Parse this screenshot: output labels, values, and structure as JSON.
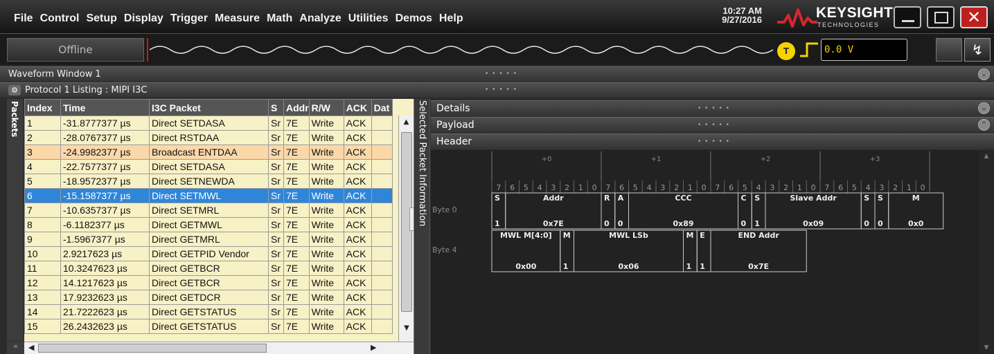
{
  "menu": [
    "File",
    "Control",
    "Setup",
    "Display",
    "Trigger",
    "Measure",
    "Math",
    "Analyze",
    "Utilities",
    "Demos",
    "Help"
  ],
  "clock": {
    "time": "10:27 AM",
    "date": "9/27/2016"
  },
  "brand": {
    "name": "KEYSIGHT",
    "sub": "TECHNOLOGIES"
  },
  "toolbar": {
    "status": "Offline",
    "trigger_label": "T",
    "trigger_level": "0.0 V"
  },
  "panels": {
    "waveform_title": "Waveform Window 1",
    "protocol_title": "Protocol 1 Listing : MIPI I3C",
    "packets_tab": "Packets",
    "selected_tab": "Selected Packet Information",
    "details": "Details",
    "payload": "Payload",
    "header": "Header"
  },
  "listing": {
    "columns": [
      "Index",
      "Time",
      "I3C Packet",
      "S",
      "Addr",
      "R/W",
      "ACK",
      "Dat"
    ],
    "rows": [
      [
        "1",
        "-31.8777377 µs",
        "Direct SETDASA",
        "Sr",
        "7E",
        "Write",
        "ACK"
      ],
      [
        "2",
        "-28.0767377 µs",
        "Direct RSTDAA",
        "Sr",
        "7E",
        "Write",
        "ACK"
      ],
      [
        "3",
        "-24.9982377 µs",
        "Broadcast ENTDAA",
        "Sr",
        "7E",
        "Write",
        "ACK"
      ],
      [
        "4",
        "-22.7577377 µs",
        "Direct SETDASA",
        "Sr",
        "7E",
        "Write",
        "ACK"
      ],
      [
        "5",
        "-18.9572377 µs",
        "Direct SETNEWDA",
        "Sr",
        "7E",
        "Write",
        "ACK"
      ],
      [
        "6",
        "-15.1587377 µs",
        "Direct SETMWL",
        "Sr",
        "7E",
        "Write",
        "ACK"
      ],
      [
        "7",
        "-10.6357377 µs",
        "Direct SETMRL",
        "Sr",
        "7E",
        "Write",
        "ACK"
      ],
      [
        "8",
        "-6.1182377 µs",
        "Direct GETMWL",
        "Sr",
        "7E",
        "Write",
        "ACK"
      ],
      [
        "9",
        "-1.5967377 µs",
        "Direct GETMRL",
        "Sr",
        "7E",
        "Write",
        "ACK"
      ],
      [
        "10",
        "2.9217623 µs",
        "Direct GETPID Vendor",
        "Sr",
        "7E",
        "Write",
        "ACK"
      ],
      [
        "11",
        "10.3247623 µs",
        "Direct GETBCR",
        "Sr",
        "7E",
        "Write",
        "ACK"
      ],
      [
        "12",
        "14.1217623 µs",
        "Direct GETBCR",
        "Sr",
        "7E",
        "Write",
        "ACK"
      ],
      [
        "13",
        "17.9232623 µs",
        "Direct GETDCR",
        "Sr",
        "7E",
        "Write",
        "ACK"
      ],
      [
        "14",
        "21.7222623 µs",
        "Direct GETSTATUS",
        "Sr",
        "7E",
        "Write",
        "ACK"
      ],
      [
        "15",
        "26.2432623 µs",
        "Direct GETSTATUS",
        "Sr",
        "7E",
        "Write",
        "ACK"
      ]
    ],
    "highlight_row": 3,
    "selected_row": 6
  },
  "header_view": {
    "byte_offsets": [
      "+0",
      "+1",
      "+2",
      "+3"
    ],
    "bit_labels": [
      "7",
      "6",
      "5",
      "4",
      "3",
      "2",
      "1",
      "0"
    ],
    "row_labels": [
      "Byte 0",
      "Byte 4"
    ],
    "byte0_fields": [
      {
        "name": "S",
        "value": "1",
        "bits": 1
      },
      {
        "name": "Addr",
        "value": "0x7E",
        "bits": 7
      },
      {
        "name": "R",
        "value": "0",
        "bits": 1
      },
      {
        "name": "A",
        "value": "0",
        "bits": 1
      },
      {
        "name": "CCC",
        "value": "0x89",
        "bits": 8
      },
      {
        "name": "C",
        "value": "0",
        "bits": 1
      },
      {
        "name": "S",
        "value": "1",
        "bits": 1
      },
      {
        "name": "Slave Addr",
        "value": "0x09",
        "bits": 7
      },
      {
        "name": "S",
        "value": "0",
        "bits": 1
      },
      {
        "name": "S",
        "value": "0",
        "bits": 1
      },
      {
        "name": "M",
        "value": "0x0",
        "bits": 4
      }
    ],
    "byte4_fields": [
      {
        "name": "MWL M[4:0]",
        "value": "0x00",
        "bits": 5
      },
      {
        "name": "M",
        "value": "1",
        "bits": 1
      },
      {
        "name": "MWL LSb",
        "value": "0x06",
        "bits": 8
      },
      {
        "name": "M",
        "value": "1",
        "bits": 1
      },
      {
        "name": "E",
        "value": "1",
        "bits": 1
      },
      {
        "name": "END Addr",
        "value": "0x7E",
        "bits": 7
      }
    ]
  }
}
